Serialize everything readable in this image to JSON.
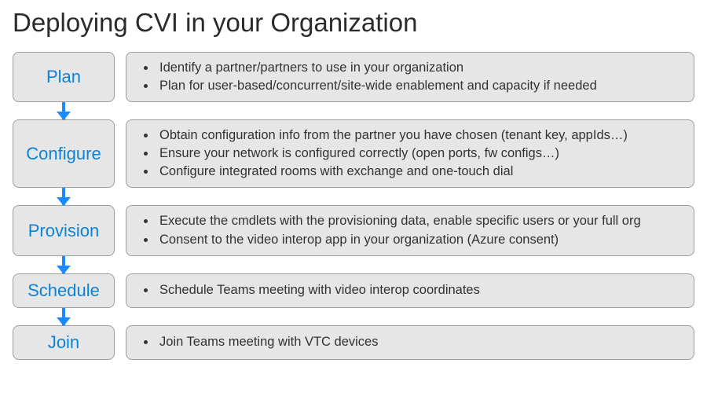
{
  "title": "Deploying CVI in your Organization",
  "steps": [
    {
      "name": "plan",
      "label": "Plan",
      "items": [
        "Identify a partner/partners to use in your organization",
        "Plan for user-based/concurrent/site-wide enablement and capacity if needed"
      ]
    },
    {
      "name": "configure",
      "label": "Configure",
      "items": [
        "Obtain configuration info from the partner you have chosen (tenant key, appIds…)",
        "Ensure your network is configured correctly (open ports, fw configs…)",
        "Configure integrated rooms with exchange and one-touch dial"
      ]
    },
    {
      "name": "provision",
      "label": "Provision",
      "items": [
        "Execute the cmdlets with the provisioning data, enable specific users or your full org",
        "Consent to the video interop app in your organization (Azure consent)"
      ]
    },
    {
      "name": "schedule",
      "label": "Schedule",
      "items": [
        "Schedule Teams meeting with video interop coordinates"
      ]
    },
    {
      "name": "join",
      "label": "Join",
      "items": [
        "Join Teams meeting with VTC devices"
      ]
    }
  ]
}
